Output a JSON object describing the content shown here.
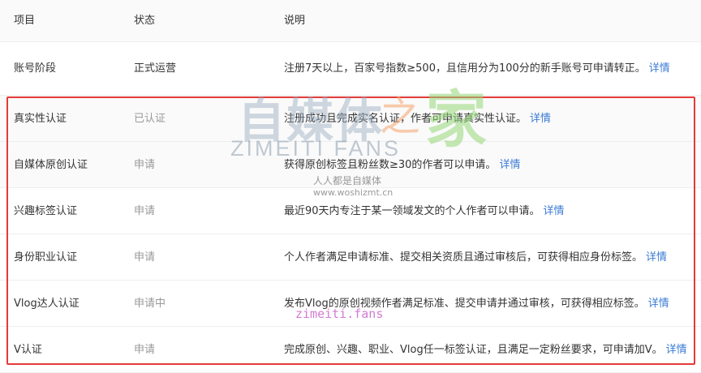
{
  "header": {
    "col_item": "项目",
    "col_status": "状态",
    "col_desc": "说明"
  },
  "rows": [
    {
      "item": "账号阶段",
      "status": "正式运营",
      "desc": "注册7天以上，百家号指数≥500，且信用分为100分的新手账号可申请转正。",
      "link": "详情"
    },
    {
      "item": "真实性认证",
      "status": "已认证",
      "desc": "注册成功且完成实名认证，作者可申请真实性认证。",
      "link": "详情"
    },
    {
      "item": "自媒体原创认证",
      "status": "申请",
      "desc": "获得原创标签且粉丝数≥30的作者可以申请。",
      "link": "详情"
    },
    {
      "item": "兴趣标签认证",
      "status": "申请",
      "desc": "最近90天内专注于某一领域发文的个人作者可以申请。",
      "link": "详情"
    },
    {
      "item": "身份职业认证",
      "status": "申请",
      "desc": "个人作者满足申请标准、提交相关资质且通过审核后，可获得相应身份标签。",
      "link": "详情"
    },
    {
      "item": "Vlog达人认证",
      "status": "申请中",
      "desc": "发布Vlog的原创视频作者满足标准、提交申请并通过审核，可获得相应标签。",
      "link": "详情"
    },
    {
      "item": "V认证",
      "status": "申请",
      "desc": "完成原创、兴趣、职业、Vlog任一标签认证，且满足一定粉丝要求，可申请加V。",
      "link": "详情"
    }
  ],
  "watermark": {
    "main": "自媒体",
    "zhi": "之",
    "jia": "家",
    "sub": "ZIMEITI FANS",
    "site_name": "人人都是自媒体",
    "site_url": "www.woshizmt.cn",
    "fans": "zimeiti.fans"
  },
  "colors": {
    "highlight_border": "#e53a3a",
    "link": "#3a7bd5",
    "muted_status": "#999999"
  }
}
